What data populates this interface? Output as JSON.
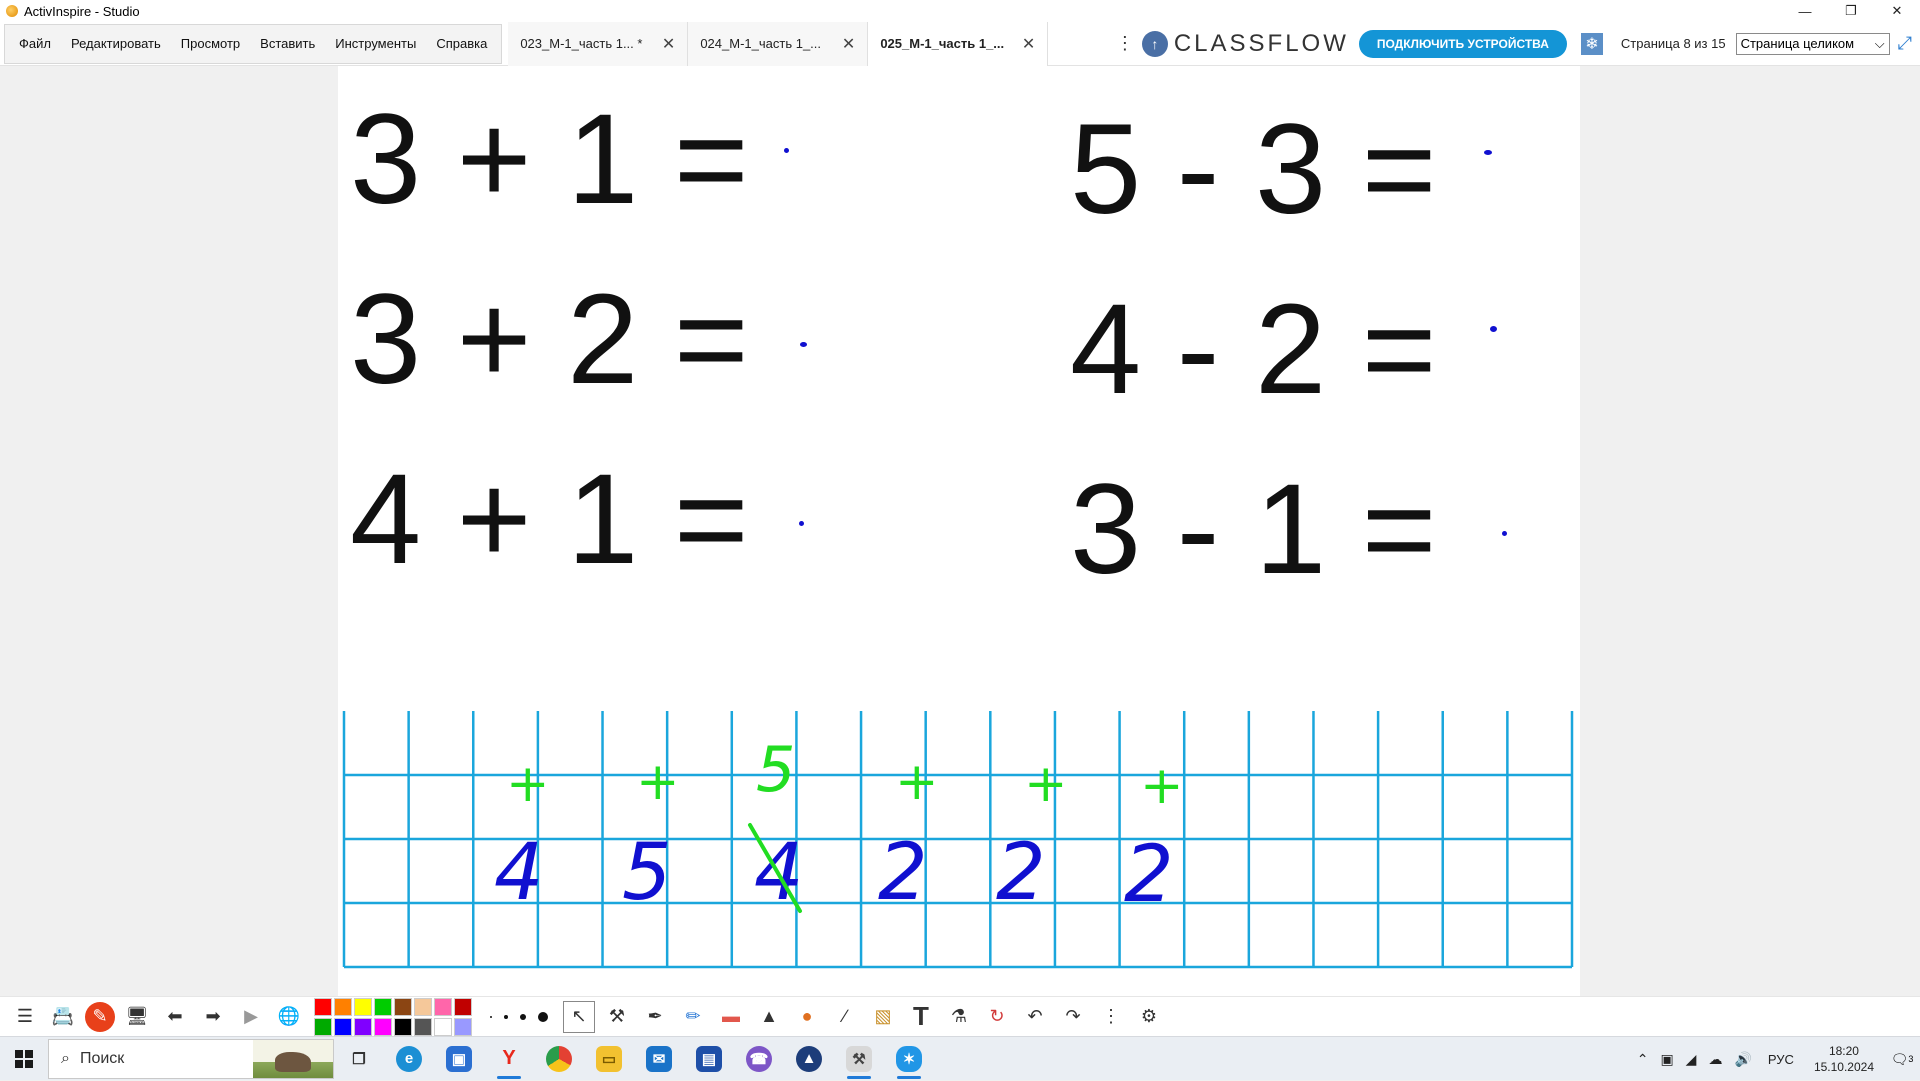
{
  "window": {
    "title": "ActivInspire - Studio"
  },
  "menu": {
    "items": [
      "Файл",
      "Редактировать",
      "Просмотр",
      "Вставить",
      "Инструменты",
      "Справка"
    ]
  },
  "tabs": [
    {
      "label": "023_М-1_часть 1... *",
      "active": false
    },
    {
      "label": "024_М-1_часть 1_...",
      "active": false
    },
    {
      "label": "025_М-1_часть 1_...",
      "active": true
    }
  ],
  "classflow": {
    "logo": "CLASSFLOW",
    "connect_label": "ПОДКЛЮЧИТЬ УСТРОЙСТВА"
  },
  "page_status": {
    "page_info": "Страница 8 из 15",
    "zoom_value": "Страница целиком"
  },
  "flipchart": {
    "expressions": [
      "3 + 1 =",
      "3 + 2 =",
      "4 + 1 =",
      "5 - 3 =",
      "4 - 2 =",
      "3 - 1 ="
    ],
    "handwriting": {
      "signs": [
        "+",
        "+",
        "+",
        "+",
        "+"
      ],
      "digits": [
        "4",
        "5",
        "4",
        "2",
        "2",
        "2"
      ],
      "correction": "5",
      "ink_blue": "#1010d0",
      "ink_green": "#22dd22",
      "grid_color": "#1aa6dc"
    }
  },
  "palette": {
    "colors": [
      "#ff0000",
      "#ff8000",
      "#ffff00",
      "#00cc00",
      "#8b4513",
      "#f5c89a",
      "#ff66aa",
      "#c00000",
      "#00aa00",
      "#0000ff",
      "#8000ff",
      "#ff00ff",
      "#000000",
      "#555555",
      "#ffffff",
      "#9999ff"
    ]
  },
  "taskbar": {
    "search_placeholder": "Поиск",
    "lang": "РУС",
    "time": "18:20",
    "date": "15.10.2024",
    "notif_count": "3"
  }
}
